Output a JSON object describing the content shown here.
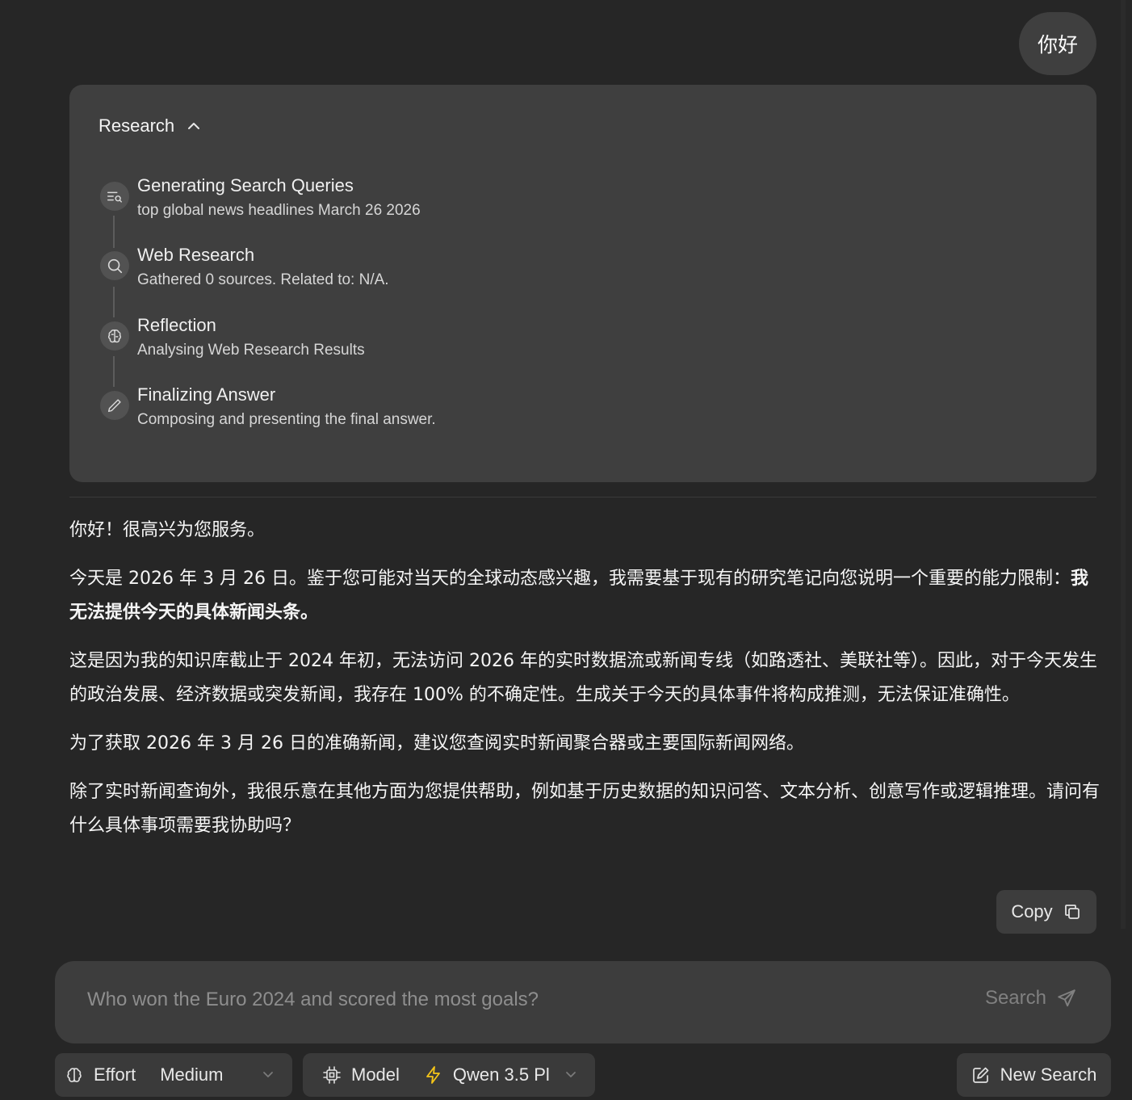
{
  "user_message": "你好",
  "research": {
    "label": "Research",
    "steps": [
      {
        "title": "Generating Search Queries",
        "desc": "top global news headlines March 26 2026",
        "icon": "search-queries-icon"
      },
      {
        "title": "Web Research",
        "desc": "Gathered 0 sources. Related to: N/A.",
        "icon": "search-icon"
      },
      {
        "title": "Reflection",
        "desc": "Analysing Web Research Results",
        "icon": "brain-icon"
      },
      {
        "title": "Finalizing Answer",
        "desc": "Composing and presenting the final answer.",
        "icon": "pencil-icon"
      }
    ]
  },
  "answer": {
    "p1": "你好！很高兴为您服务。",
    "p2_text": "今天是 2026 年 3 月 26 日。鉴于您可能对当天的全球动态感兴趣，我需要基于现有的研究笔记向您说明一个重要的能力限制：",
    "p2_bold": "我无法提供今天的具体新闻头条。",
    "p3": "这是因为我的知识库截止于 2024 年初，无法访问 2026 年的实时数据流或新闻专线（如路透社、美联社等）。因此，对于今天发生的政治发展、经济数据或突发新闻，我存在 100% 的不确定性。生成关于今天的具体事件将构成推测，无法保证准确性。",
    "p4": "为了获取 2026 年 3 月 26 日的准确新闻，建议您查阅实时新闻聚合器或主要国际新闻网络。",
    "p5": "除了实时新闻查询外，我很乐意在其他方面为您提供帮助，例如基于历史数据的知识问答、文本分析、创意写作或逻辑推理。请问有什么具体事项需要我协助吗？"
  },
  "copy_label": "Copy",
  "input": {
    "placeholder": "Who won the Euro 2024 and scored the most goals?",
    "value": "",
    "submit_label": "Search"
  },
  "controls": {
    "effort_label": "Effort",
    "effort_value": "Medium",
    "model_label": "Model",
    "model_value": "Qwen 3.5 Pl",
    "new_search_label": "New Search"
  },
  "colors": {
    "background": "#262626",
    "card": "#3f3f3f",
    "accent_lightning": "#f5c518"
  }
}
